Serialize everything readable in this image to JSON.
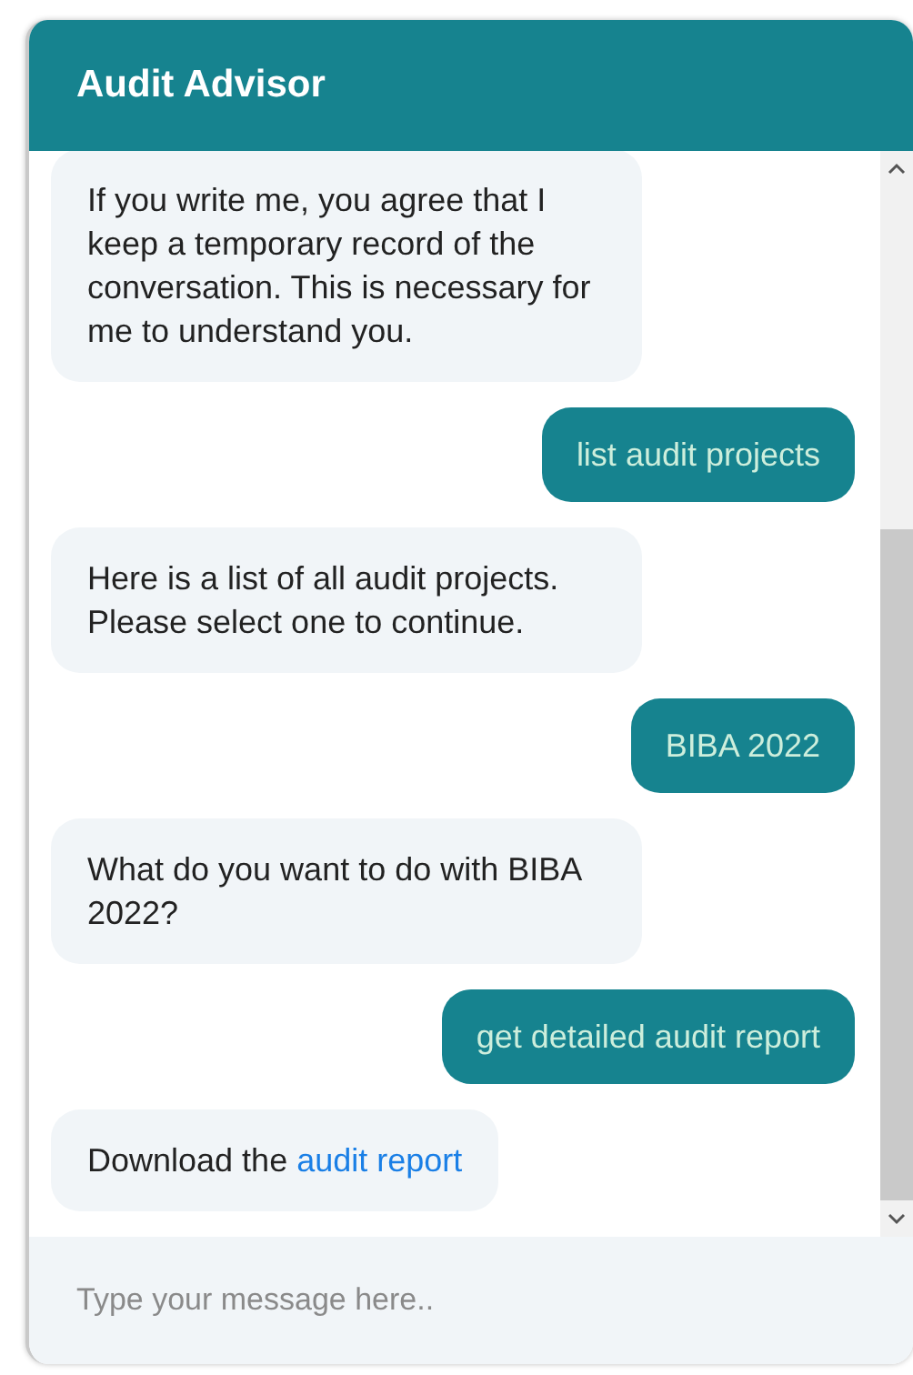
{
  "header": {
    "title": "Audit Advisor"
  },
  "messages": [
    {
      "kind": "bot",
      "text": "If you write me, you agree that I keep a temporary record of the conversation. This is necessary for me to understand you."
    },
    {
      "kind": "user",
      "text": "list audit projects"
    },
    {
      "kind": "bot",
      "text": "Here is a list of all audit projects. Please select one to continue."
    },
    {
      "kind": "user",
      "text": "BIBA 2022"
    },
    {
      "kind": "bot",
      "text": "What do you want to do with BIBA 2022?"
    },
    {
      "kind": "user",
      "text": "get detailed audit report"
    },
    {
      "kind": "bot",
      "text": "Download the ",
      "link": "audit report"
    }
  ],
  "composer": {
    "placeholder": "Type your message here.."
  }
}
